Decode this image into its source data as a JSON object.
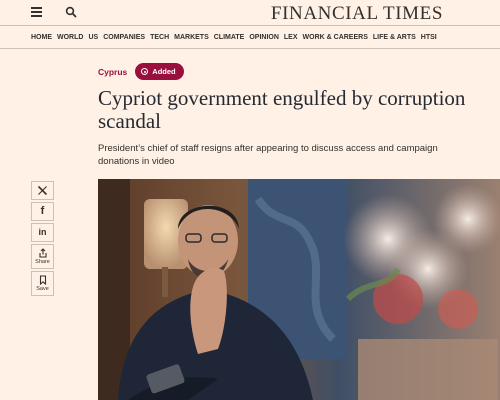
{
  "header": {
    "logo": "FINANCIAL TIMES",
    "menu_icon": "menu-icon",
    "search_icon": "search-icon"
  },
  "nav": {
    "items": [
      "HOME",
      "WORLD",
      "US",
      "COMPANIES",
      "TECH",
      "MARKETS",
      "CLIMATE",
      "OPINION",
      "LEX",
      "WORK & CAREERS",
      "LIFE & ARTS",
      "HTSI"
    ]
  },
  "article": {
    "topic": "Cyprus",
    "badge": "Added",
    "headline": "Cypriot government engulfed by corruption scandal",
    "standfirst": "President’s chief of staff resigns after appearing to discuss access and campaign donations in video"
  },
  "share": {
    "x_icon": "x-icon",
    "facebook_icon": "facebook-icon",
    "linkedin_icon": "linkedin-icon",
    "share_label": "Share",
    "save_label": "Save"
  },
  "colors": {
    "background": "#fff1e5",
    "accent": "#990f3d",
    "text": "#33302e"
  }
}
